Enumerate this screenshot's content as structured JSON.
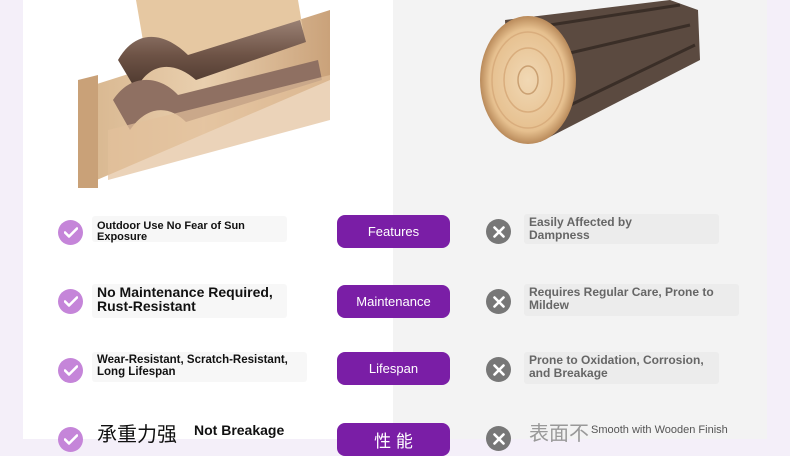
{
  "comparison": {
    "rows": [
      {
        "left": "Outdoor Use No Fear of Sun Exposure",
        "label": "Features",
        "right": "Easily Affected by Dampness"
      },
      {
        "left": "No Maintenance Required, Rust-Resistant",
        "label": "Maintenance",
        "right": "Requires Regular Care, Prone to Mildew"
      },
      {
        "left": "Wear-Resistant, Scratch-Resistant, Long Lifespan",
        "label": "Lifespan",
        "right": "Prone to Oxidation, Corrosion, and Breakage"
      },
      {
        "left_cn": "承重力强",
        "left": "Not Breakage",
        "label": "性 能",
        "right_cn": "表面不",
        "right": "Smooth with Wooden Finish"
      }
    ]
  },
  "colors": {
    "accent": "#7a1ea6",
    "check": "#c585d9",
    "cross": "#777777"
  },
  "icons": [
    "check-icon",
    "close-icon"
  ]
}
